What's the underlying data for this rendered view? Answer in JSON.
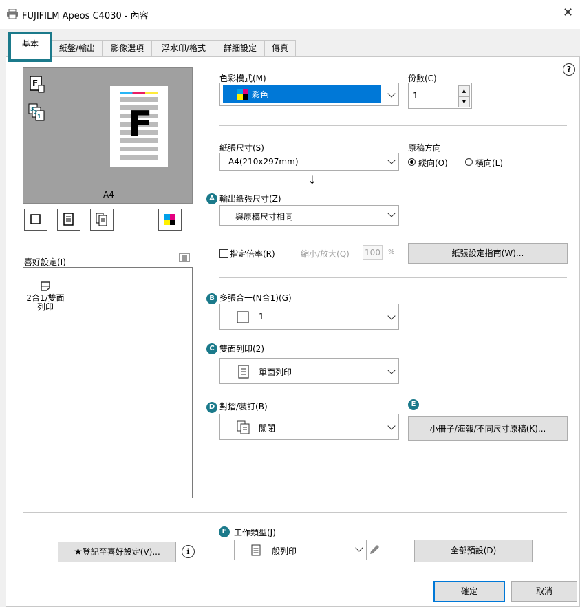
{
  "window": {
    "title": "FUJIFILM Apeos C4030 - 內容"
  },
  "tabs": [
    {
      "label": "基本"
    },
    {
      "label": "紙盤/輸出"
    },
    {
      "label": "影像選項"
    },
    {
      "label": "浮水印/格式"
    },
    {
      "label": "詳細設定"
    },
    {
      "label": "傳真"
    }
  ],
  "preview": {
    "paper_label": "A4"
  },
  "favorites": {
    "label": "喜好設定(I)",
    "items": [
      {
        "line1": "2合1/雙面",
        "line2": "列印"
      }
    ]
  },
  "color_mode": {
    "label": "色彩模式(M)",
    "value": "彩色"
  },
  "copies": {
    "label": "份數(C)",
    "value": "1"
  },
  "paper_size": {
    "label": "紙張尺寸(S)",
    "value": "A4(210x297mm)"
  },
  "orientation": {
    "label": "原稿方向",
    "portrait": "縱向(O)",
    "landscape": "橫向(L)",
    "selected": "portrait"
  },
  "arrow": "↓",
  "output_size": {
    "badge": "A",
    "label": "輸出紙張尺寸(Z)",
    "value": "與原稿尺寸相同"
  },
  "scale": {
    "checkbox_label": "指定倍率(R)",
    "zoom_label": "縮小/放大(Q)",
    "zoom_value": "100",
    "unit": "%"
  },
  "paper_guide_button": "紙張設定指南(W)...",
  "nup": {
    "badge": "B",
    "label": "多張合一(N合1)(G)",
    "value": "1"
  },
  "duplex": {
    "badge": "C",
    "label": "雙面列印(2)",
    "value": "單面列印"
  },
  "finishing": {
    "badge": "D",
    "label": "對摺/裝訂(B)",
    "value": "關閉"
  },
  "booklet": {
    "badge": "E",
    "button": "小冊子/海報/不同尺寸原稿(K)..."
  },
  "job_type": {
    "badge": "F",
    "label": "工作類型(J)",
    "value": "一般列印"
  },
  "register_button": "登記至喜好設定(V)...",
  "defaults_button": "全部預設(D)",
  "ok_button": "確定",
  "cancel_button": "取消",
  "colors": {
    "accent": "#1b7a8b",
    "selected": "#0078d7"
  }
}
